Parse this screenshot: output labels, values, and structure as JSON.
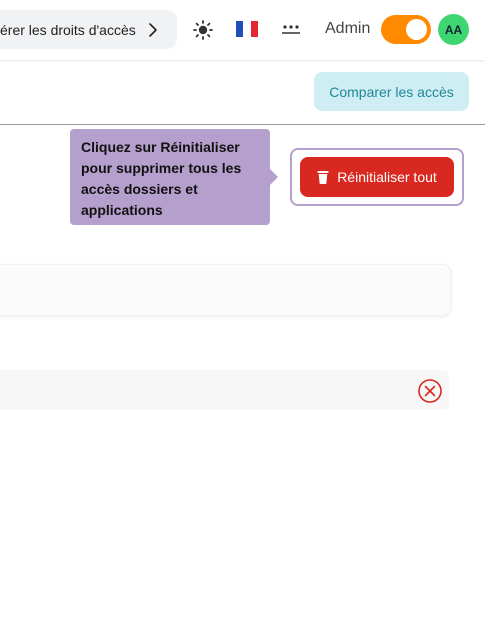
{
  "header": {
    "breadcrumb_text": "érer les droits d'accès",
    "user_label": "Admin",
    "avatar_initials": "AA",
    "toggle_on": true,
    "icons": {
      "chevron": "chevron-right-icon",
      "theme": "sun-icon",
      "language": "france-flag-icon",
      "password": "password-dots-icon"
    },
    "colors": {
      "toggle": "#ff8a00",
      "avatar": "#3ed670"
    }
  },
  "toolbar": {
    "compare_label": "Comparer les accès",
    "compare_color": "#cfeef3"
  },
  "tour": {
    "tooltip_text": "Cliquez sur Réinitialiser pour supprimer tous les accès dossiers et applications",
    "tooltip_color": "#b59fcc"
  },
  "actions": {
    "reset_all_label": "Réinitialiser tout",
    "reset_color": "#d8281f",
    "reset_icon": "trash-icon"
  },
  "content": {
    "remove_icon": "close-circle-icon",
    "remove_color": "#d8281f"
  }
}
